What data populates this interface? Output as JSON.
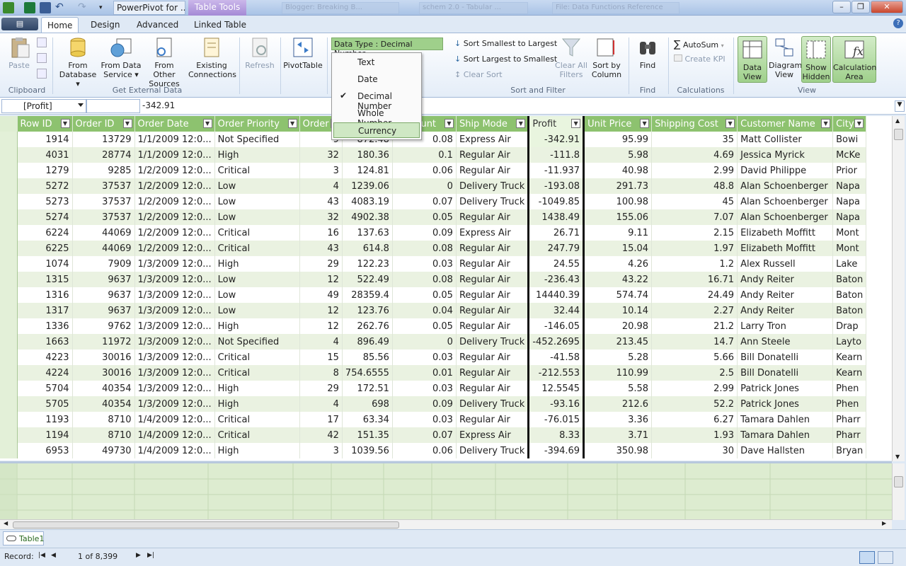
{
  "titlebar": {
    "app_title": "PowerPivot for ...",
    "contextual_tab": "Table Tools",
    "ghost_tab_1": "Blogger: Breaking B...",
    "ghost_tab_2": "schem 2.0 - Tabular ...",
    "ghost_tab_3": "File: Data Functions Reference"
  },
  "menu": {
    "file_label": "▤",
    "tabs": [
      "Home",
      "Design",
      "Advanced",
      "Linked Table"
    ]
  },
  "ribbon": {
    "clipboard": {
      "paste": "Paste",
      "group": "Clipboard"
    },
    "external": {
      "from_database": [
        "From",
        "Database ▾"
      ],
      "from_data_service": [
        "From Data",
        "Service ▾"
      ],
      "from_other_sources": [
        "From Other",
        "Sources"
      ],
      "existing_connections": [
        "Existing",
        "Connections"
      ],
      "group": "Get External Data"
    },
    "refresh": "Refresh",
    "pivottable": "PivotTable",
    "data_type": "Data Type : Decimal Number",
    "sort": {
      "smallest": "Sort Smallest to Largest",
      "largest": "Sort Largest to Smallest",
      "clear_sort": "Clear Sort",
      "clear_filters": [
        "Clear All",
        "Filters"
      ],
      "sort_by_column": [
        "Sort by",
        "Column"
      ],
      "group": "Sort and Filter"
    },
    "find": {
      "label": "Find",
      "group": "Find"
    },
    "calc": {
      "autosum": "AutoSum",
      "create_kpi": "Create KPI",
      "group": "Calculations"
    },
    "view": {
      "data_view": [
        "Data",
        "View"
      ],
      "diagram_view": [
        "Diagram",
        "View"
      ],
      "show_hidden": [
        "Show",
        "Hidden"
      ],
      "calculation_area": [
        "Calculation",
        "Area"
      ],
      "group": "View"
    }
  },
  "datatype_menu": {
    "items": [
      "Text",
      "Date",
      "Decimal Number",
      "Whole Number",
      "Currency"
    ],
    "checked": "Decimal Number",
    "hovered": "Currency"
  },
  "formula": {
    "name_box": "[Profit]",
    "value": "-342.91"
  },
  "table": {
    "columns": [
      "Row ID",
      "Order ID",
      "Order Date",
      "Order Priority",
      "Order Q",
      "Sales",
      "Discount",
      "Ship Mode",
      "Profit",
      "Unit Price",
      "Shipping Cost",
      "Customer Name",
      "City"
    ],
    "rows": [
      [
        "1914",
        "13729",
        "1/1/2009 12:0...",
        "Not Specified",
        "9",
        "872.48",
        "0.08",
        "Express Air",
        "-342.91",
        "95.99",
        "35",
        "Matt Collister",
        "Bowi"
      ],
      [
        "4031",
        "28774",
        "1/1/2009 12:0...",
        "High",
        "32",
        "180.36",
        "0.1",
        "Regular Air",
        "-111.8",
        "5.98",
        "4.69",
        "Jessica Myrick",
        "McKe"
      ],
      [
        "1279",
        "9285",
        "1/2/2009 12:0...",
        "Critical",
        "3",
        "124.81",
        "0.06",
        "Regular Air",
        "-11.937",
        "40.98",
        "2.99",
        "David Philippe",
        "Prior"
      ],
      [
        "5272",
        "37537",
        "1/2/2009 12:0...",
        "Low",
        "4",
        "1239.06",
        "0",
        "Delivery Truck",
        "-193.08",
        "291.73",
        "48.8",
        "Alan Schoenberger",
        "Napa"
      ],
      [
        "5273",
        "37537",
        "1/2/2009 12:0...",
        "Low",
        "43",
        "4083.19",
        "0.07",
        "Delivery Truck",
        "-1049.85",
        "100.98",
        "45",
        "Alan Schoenberger",
        "Napa"
      ],
      [
        "5274",
        "37537",
        "1/2/2009 12:0...",
        "Low",
        "32",
        "4902.38",
        "0.05",
        "Regular Air",
        "1438.49",
        "155.06",
        "7.07",
        "Alan Schoenberger",
        "Napa"
      ],
      [
        "6224",
        "44069",
        "1/2/2009 12:0...",
        "Critical",
        "16",
        "137.63",
        "0.09",
        "Express Air",
        "26.71",
        "9.11",
        "2.15",
        "Elizabeth Moffitt",
        "Mont"
      ],
      [
        "6225",
        "44069",
        "1/2/2009 12:0...",
        "Critical",
        "43",
        "614.8",
        "0.08",
        "Regular Air",
        "247.79",
        "15.04",
        "1.97",
        "Elizabeth Moffitt",
        "Mont"
      ],
      [
        "1074",
        "7909",
        "1/3/2009 12:0...",
        "High",
        "29",
        "122.23",
        "0.03",
        "Regular Air",
        "24.55",
        "4.26",
        "1.2",
        "Alex Russell",
        "Lake"
      ],
      [
        "1315",
        "9637",
        "1/3/2009 12:0...",
        "Low",
        "12",
        "522.49",
        "0.08",
        "Regular Air",
        "-236.43",
        "43.22",
        "16.71",
        "Andy Reiter",
        "Baton"
      ],
      [
        "1316",
        "9637",
        "1/3/2009 12:0...",
        "Low",
        "49",
        "28359.4",
        "0.05",
        "Regular Air",
        "14440.39",
        "574.74",
        "24.49",
        "Andy Reiter",
        "Baton"
      ],
      [
        "1317",
        "9637",
        "1/3/2009 12:0...",
        "Low",
        "12",
        "123.76",
        "0.04",
        "Regular Air",
        "32.44",
        "10.14",
        "2.27",
        "Andy Reiter",
        "Baton"
      ],
      [
        "1336",
        "9762",
        "1/3/2009 12:0...",
        "High",
        "12",
        "262.76",
        "0.05",
        "Regular Air",
        "-146.05",
        "20.98",
        "21.2",
        "Larry Tron",
        "Drap"
      ],
      [
        "1663",
        "11972",
        "1/3/2009 12:0...",
        "Not Specified",
        "4",
        "896.49",
        "0",
        "Delivery Truck",
        "-452.2695",
        "213.45",
        "14.7",
        "Ann Steele",
        "Layto"
      ],
      [
        "4223",
        "30016",
        "1/3/2009 12:0...",
        "Critical",
        "15",
        "85.56",
        "0.03",
        "Regular Air",
        "-41.58",
        "5.28",
        "5.66",
        "Bill Donatelli",
        "Kearn"
      ],
      [
        "4224",
        "30016",
        "1/3/2009 12:0...",
        "Critical",
        "8",
        "754.6555",
        "0.01",
        "Regular Air",
        "-212.553",
        "110.99",
        "2.5",
        "Bill Donatelli",
        "Kearn"
      ],
      [
        "5704",
        "40354",
        "1/3/2009 12:0...",
        "High",
        "29",
        "172.51",
        "0.03",
        "Regular Air",
        "12.5545",
        "5.58",
        "2.99",
        "Patrick Jones",
        "Phen"
      ],
      [
        "5705",
        "40354",
        "1/3/2009 12:0...",
        "High",
        "4",
        "698",
        "0.09",
        "Delivery Truck",
        "-93.16",
        "212.6",
        "52.2",
        "Patrick Jones",
        "Phen"
      ],
      [
        "1193",
        "8710",
        "1/4/2009 12:0...",
        "Critical",
        "17",
        "63.34",
        "0.03",
        "Regular Air",
        "-76.015",
        "3.36",
        "6.27",
        "Tamara Dahlen",
        "Pharr"
      ],
      [
        "1194",
        "8710",
        "1/4/2009 12:0...",
        "Critical",
        "42",
        "151.35",
        "0.07",
        "Express Air",
        "8.33",
        "3.71",
        "1.93",
        "Tamara Dahlen",
        "Pharr"
      ],
      [
        "6953",
        "49730",
        "1/4/2009 12:0...",
        "High",
        "3",
        "1039.56",
        "0.06",
        "Delivery Truck",
        "-394.69",
        "350.98",
        "30",
        "Dave Hallsten",
        "Bryan"
      ]
    ]
  },
  "sheet_tab": "Table1",
  "status": {
    "record_label": "Record:",
    "position": "1 of 8,399"
  }
}
